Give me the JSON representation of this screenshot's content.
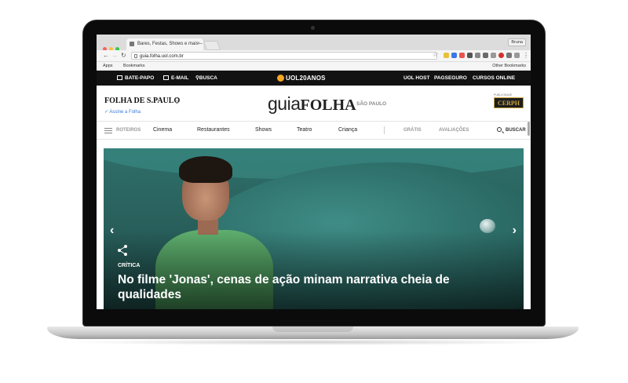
{
  "browser": {
    "tab_title": "Bares, Festas, Shows e mais –",
    "user_label": "Bruna",
    "url": "guia.folha.uol.com.br",
    "bookmarks": {
      "apps": "Apps",
      "bookmarks": "Bookmarks",
      "other": "Other Bookmarks"
    }
  },
  "uol_bar": {
    "left_items": [
      "BATE-PAPO",
      "E-MAIL",
      "BUSCA"
    ],
    "logo": "UOL20ANOS",
    "right_items": [
      "UOL HOST",
      "PAGSEGURO",
      "CURSOS ONLINE"
    ]
  },
  "site": {
    "folha_logo": "FOLHA DE S.PAULO",
    "assine": "✓ Assine a Folha",
    "guia_light": "guia",
    "guia_bold": "FOLHA",
    "city": "SÃO PAULO",
    "ad_label": "PUBLICIDADE",
    "ad_text": "CERPH"
  },
  "nav": {
    "roteiros": "ROTEIROS",
    "items": [
      "Cinema",
      "Restaurantes",
      "Shows",
      "Teatro",
      "Criança"
    ],
    "gratis": "GRÁTIS",
    "avaliacoes": "AVALIAÇÕES",
    "buscar": "BUSCAR"
  },
  "hero": {
    "kicker": "CRÍTICA",
    "headline": "No filme 'Jonas', cenas de ação minam narrativa cheia de qualidades"
  },
  "colors": {
    "uol_bar": "#121212",
    "uol_logo_ball": "#f5a623",
    "assine_blue": "#3a7bd5",
    "hero_teal": "#2f6f6a",
    "shirt_green": "#5fae6e"
  }
}
